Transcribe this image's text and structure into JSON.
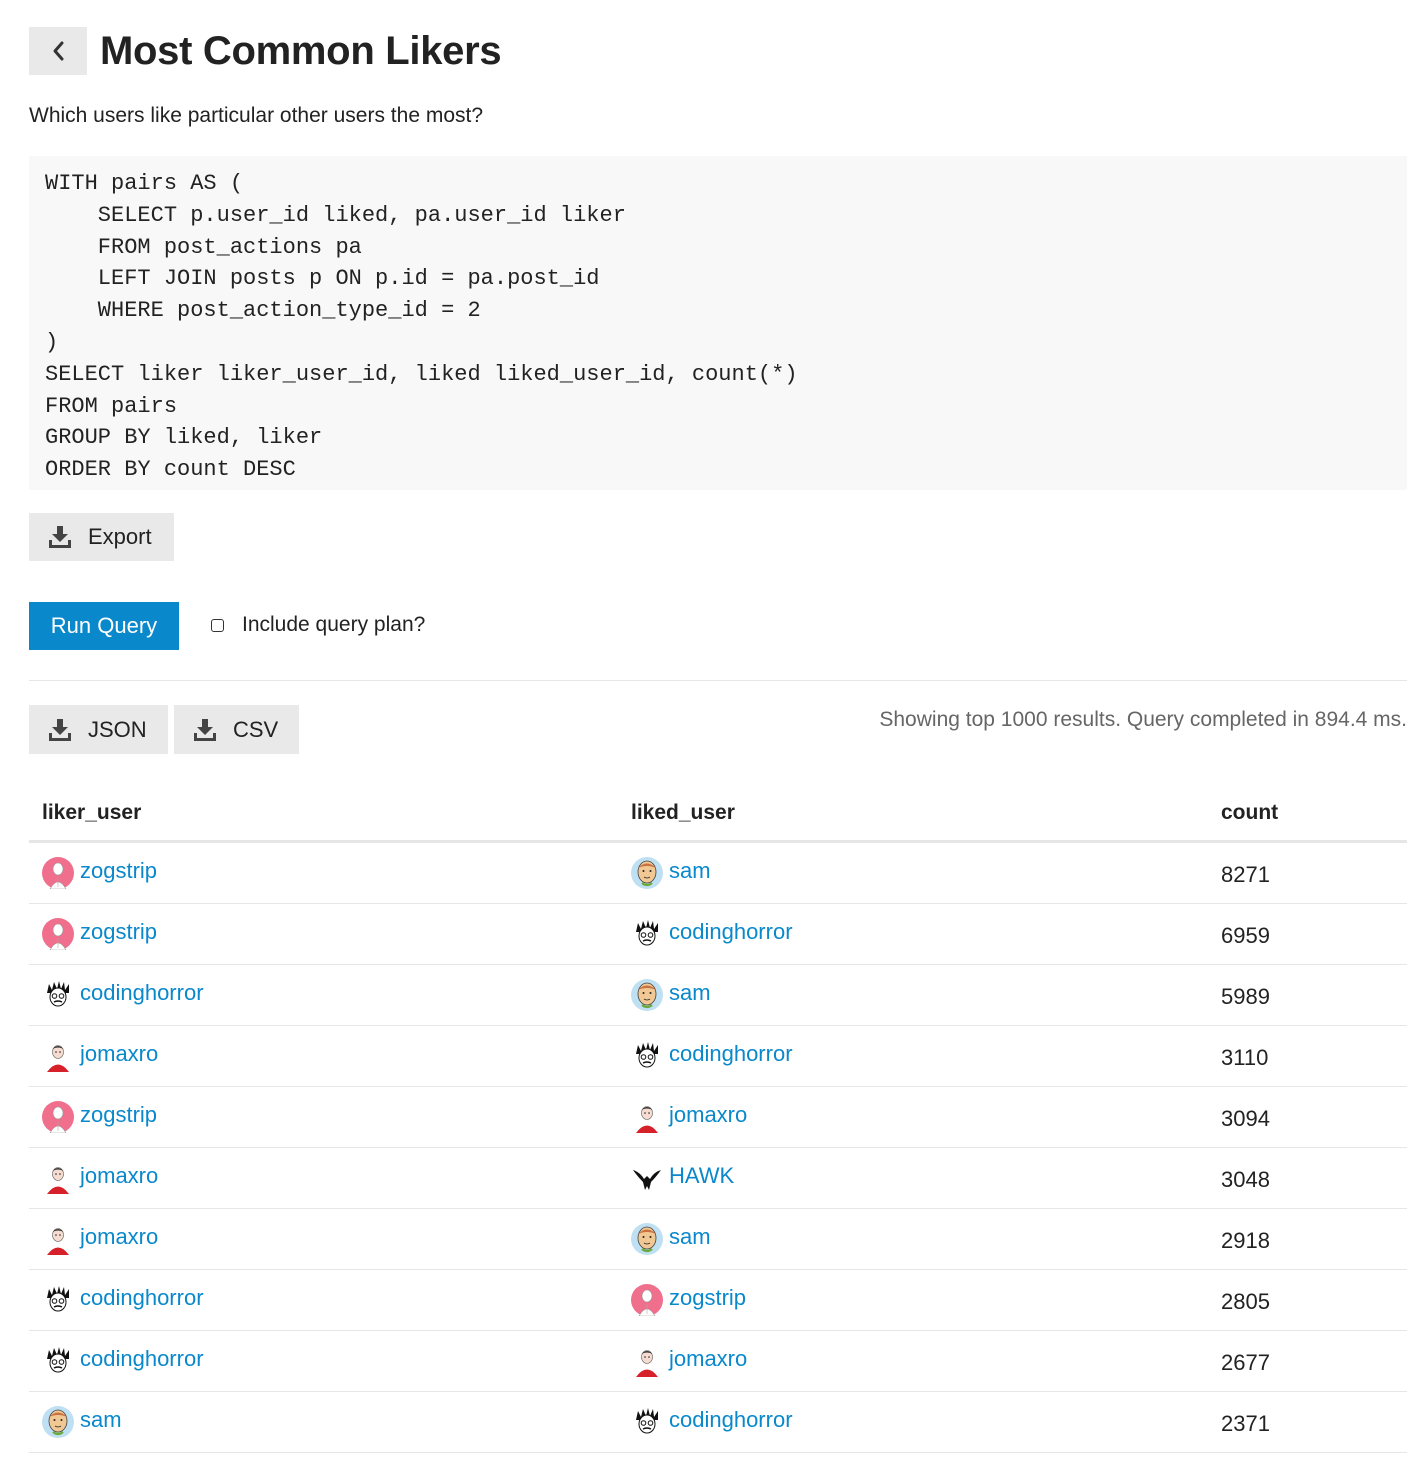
{
  "header": {
    "title": "Most Common Likers"
  },
  "description": "Which users like particular other users the most?",
  "sql": [
    "WITH pairs AS (",
    "    SELECT p.user_id liked, pa.user_id liker",
    "    FROM post_actions pa",
    "    LEFT JOIN posts p ON p.id = pa.post_id",
    "    WHERE post_action_type_id = 2",
    ")",
    "SELECT liker liker_user_id, liked liked_user_id, count(*)",
    "FROM pairs",
    "GROUP BY liked, liker",
    "ORDER BY count DESC"
  ],
  "buttons": {
    "export": "Export",
    "run_query": "Run Query",
    "json": "JSON",
    "csv": "CSV"
  },
  "include_plan_label": "Include query plan?",
  "result_info": "Showing top 1000 results. Query completed in 894.4 ms.",
  "table": {
    "headers": [
      "liker_user",
      "liked_user",
      "count"
    ],
    "rows": [
      {
        "liker": "zogstrip",
        "liked": "sam",
        "count": "8271"
      },
      {
        "liker": "zogstrip",
        "liked": "codinghorror",
        "count": "6959"
      },
      {
        "liker": "codinghorror",
        "liked": "sam",
        "count": "5989"
      },
      {
        "liker": "jomaxro",
        "liked": "codinghorror",
        "count": "3110"
      },
      {
        "liker": "zogstrip",
        "liked": "jomaxro",
        "count": "3094"
      },
      {
        "liker": "jomaxro",
        "liked": "HAWK",
        "count": "3048"
      },
      {
        "liker": "jomaxro",
        "liked": "sam",
        "count": "2918"
      },
      {
        "liker": "codinghorror",
        "liked": "zogstrip",
        "count": "2805"
      },
      {
        "liker": "codinghorror",
        "liked": "jomaxro",
        "count": "2677"
      },
      {
        "liker": "sam",
        "liked": "codinghorror",
        "count": "2371"
      }
    ]
  },
  "colors": {
    "link": "#0a88cc",
    "primary_button": "#0a88cc",
    "button_gray": "#e9e9e9",
    "code_bg": "#f8f8f8"
  }
}
